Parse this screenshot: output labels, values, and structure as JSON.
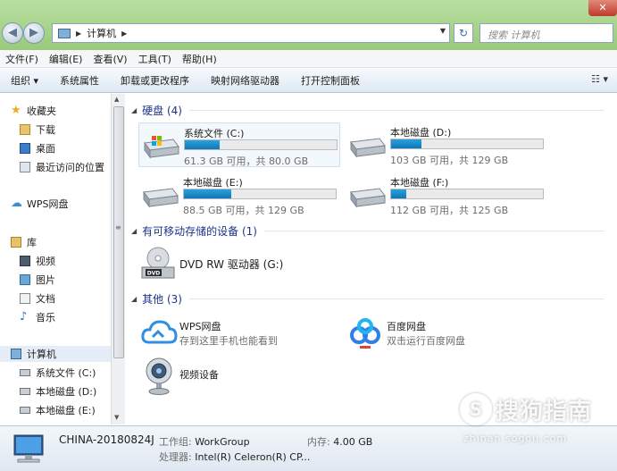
{
  "window": {
    "close_glyph": "✕"
  },
  "nav": {
    "back": "◀",
    "forward": "▶"
  },
  "address": {
    "segment": "计算机",
    "sep": "▶",
    "drop": "▼"
  },
  "refresh_glyph": "↻",
  "search": {
    "placeholder": "搜索 计算机"
  },
  "menu": [
    "文件(F)",
    "编辑(E)",
    "查看(V)",
    "工具(T)",
    "帮助(H)"
  ],
  "toolbar": {
    "items": [
      "组织 ▾",
      "系统属性",
      "卸载或更改程序",
      "映射网络驱动器",
      "打开控制面板"
    ],
    "view_btn": "☷ ▾"
  },
  "sidebar": {
    "items": [
      {
        "label": "收藏夹",
        "icon": "star-icon"
      },
      {
        "label": "下载",
        "icon": "download-folder-icon"
      },
      {
        "label": "桌面",
        "icon": "desktop-icon"
      },
      {
        "label": "最近访问的位置",
        "icon": "recent-places-icon"
      },
      {
        "label": "WPS网盘",
        "icon": "cloud-icon"
      },
      {
        "label": "库",
        "icon": "library-icon"
      },
      {
        "label": "视频",
        "icon": "video-icon"
      },
      {
        "label": "图片",
        "icon": "picture-icon"
      },
      {
        "label": "文档",
        "icon": "document-icon"
      },
      {
        "label": "音乐",
        "icon": "music-icon"
      },
      {
        "label": "计算机",
        "icon": "computer-icon"
      },
      {
        "label": "系统文件 (C:)",
        "icon": "drive-icon"
      },
      {
        "label": "本地磁盘 (D:)",
        "icon": "drive-icon"
      },
      {
        "label": "本地磁盘 (E:)",
        "icon": "drive-icon"
      }
    ]
  },
  "groups": {
    "hard_disks": "硬盘 (4)",
    "removable": "有可移动存储的设备 (1)",
    "other": "其他 (3)",
    "tri": "◢"
  },
  "drives": [
    {
      "name": "系统文件 (C:)",
      "free": "61.3 GB 可用，共 80.0 GB",
      "used_fraction": 0.23
    },
    {
      "name": "本地磁盘 (D:)",
      "free": "103 GB 可用，共 129 GB",
      "used_fraction": 0.2
    },
    {
      "name": "本地磁盘 (E:)",
      "free": "88.5 GB 可用，共 129 GB",
      "used_fraction": 0.31
    },
    {
      "name": "本地磁盘 (F:)",
      "free": "112 GB 可用，共 125 GB",
      "used_fraction": 0.1
    }
  ],
  "dvd": {
    "name": "DVD RW 驱动器 (G:)",
    "icon_text": "DVD"
  },
  "others": [
    {
      "name": "WPS网盘",
      "sub": "存到这里手机也能看到"
    },
    {
      "name": "百度网盘",
      "sub": "双击运行百度网盘"
    },
    {
      "name": "视频设备",
      "sub": ""
    }
  ],
  "status": {
    "computer_name": "CHINA-20180824J",
    "workgroup_label": "工作组:",
    "workgroup": "WorkGroup",
    "memory_label": "内存:",
    "memory": "4.00 GB",
    "cpu_label": "处理器:",
    "cpu": "Intel(R) Celeron(R) CP..."
  },
  "watermark": {
    "text": "搜狗指南",
    "url": "zhinan.sogou.com",
    "circle": "S"
  }
}
